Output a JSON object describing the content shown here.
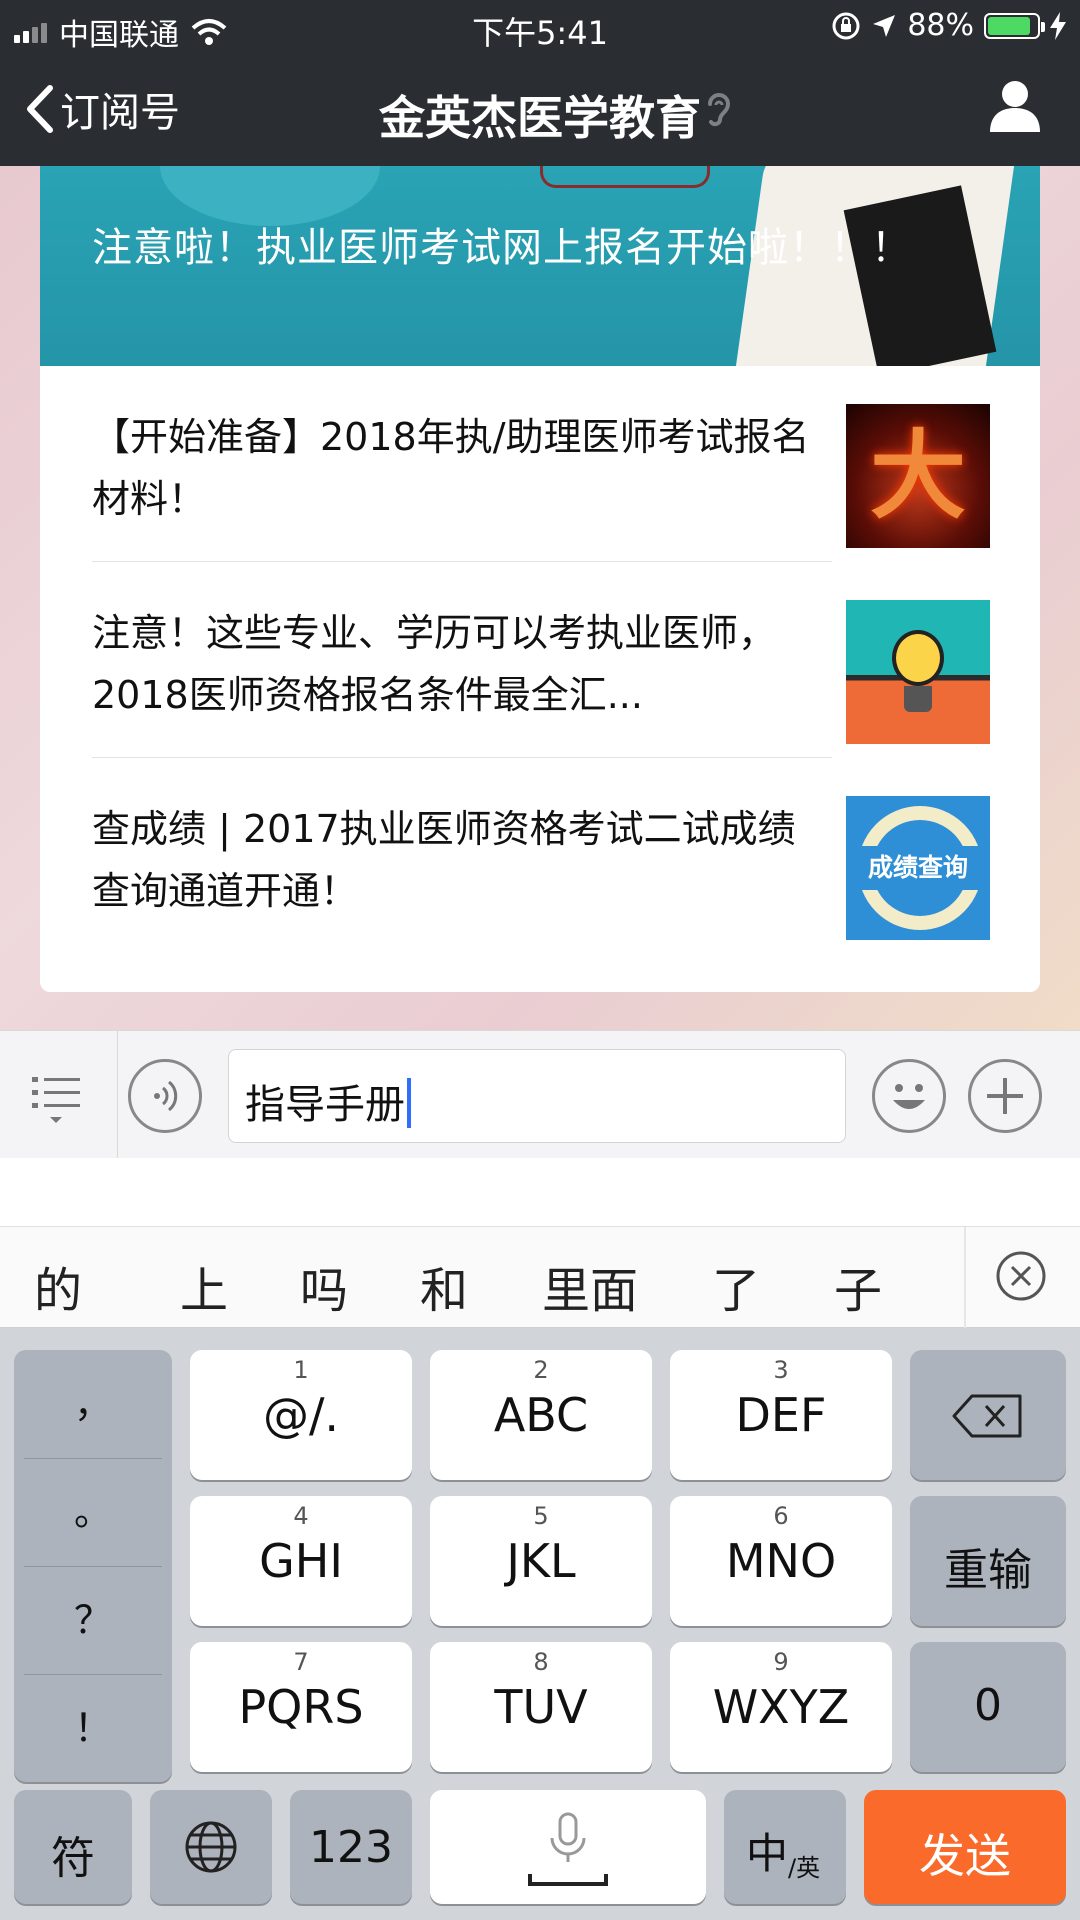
{
  "status_bar": {
    "carrier": "中国联通",
    "time": "下午5:41",
    "battery": "88%"
  },
  "nav": {
    "back_label": "订阅号",
    "title": "金英杰医学教育"
  },
  "article_card": {
    "banner_title": "注意啦！执业医师考试网上报名开始啦！！！",
    "items": [
      {
        "title": "【开始准备】2018年执/助理医师考试报名材料！",
        "thumb_text": "大事"
      },
      {
        "title": "注意！这些专业、学历可以考执业医师，2018医师资格报名条件最全汇...",
        "thumb_text": ""
      },
      {
        "title": "查成绩 | 2017执业医师资格考试二试成绩查询通道开通！",
        "thumb_text": "成绩查询"
      }
    ]
  },
  "input": {
    "value": "指导手册"
  },
  "candidates": [
    "的",
    "上",
    "吗",
    "和",
    "里面",
    "了",
    "子"
  ],
  "keyboard": {
    "punct": [
      "，",
      "。",
      "？",
      "！"
    ],
    "keys": [
      {
        "num": "1",
        "label": "@/."
      },
      {
        "num": "2",
        "label": "ABC"
      },
      {
        "num": "3",
        "label": "DEF"
      },
      {
        "num": "4",
        "label": "GHI"
      },
      {
        "num": "5",
        "label": "JKL"
      },
      {
        "num": "6",
        "label": "MNO"
      },
      {
        "num": "7",
        "label": "PQRS"
      },
      {
        "num": "8",
        "label": "TUV"
      },
      {
        "num": "9",
        "label": "WXYZ"
      }
    ],
    "reenter": "重输",
    "zero": "0",
    "symbols": "符",
    "numbers": "123",
    "lang_main": "中",
    "lang_sub": "/英",
    "send": "发送"
  },
  "colors": {
    "nav_bg": "#2a2d31",
    "send_bg": "#fa6b2b",
    "banner_bg": "#29a3b5",
    "battery_fill": "#4cd964",
    "caret": "#2f6dfa"
  }
}
